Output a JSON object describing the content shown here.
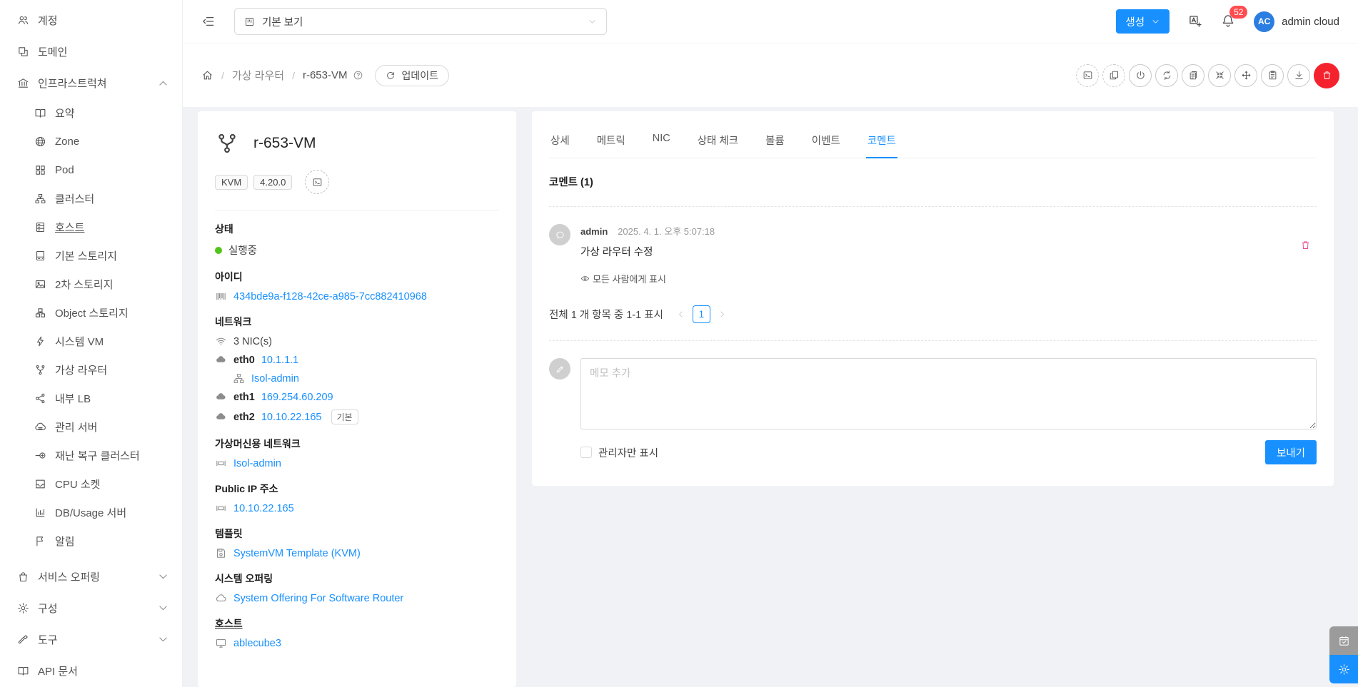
{
  "colors": {
    "primary": "#1890ff",
    "status_running": "#52c41a",
    "badge": "#ff4d4f",
    "danger": "#f5222d"
  },
  "header": {
    "view_select": {
      "value": "기본 보기"
    },
    "create_button": {
      "label": "생성"
    },
    "notification_count": "52",
    "user": {
      "initials": "AC",
      "name": "admin cloud"
    }
  },
  "breadcrumb": {
    "section": "가상 라우터",
    "current": "r-653-VM",
    "update_button": "업데이트"
  },
  "toolbar": [
    {
      "key": "console",
      "icon": "console",
      "style": "dashed"
    },
    {
      "key": "copy",
      "icon": "copy",
      "style": "dashed"
    },
    {
      "key": "power",
      "icon": "power",
      "style": "solid"
    },
    {
      "key": "restart",
      "icon": "sync",
      "style": "solid"
    },
    {
      "key": "diagnostics",
      "icon": "diagnostics",
      "style": "solid"
    },
    {
      "key": "scale",
      "icon": "shrink",
      "style": "solid"
    },
    {
      "key": "migrate",
      "icon": "migrate",
      "style": "solid"
    },
    {
      "key": "health-check",
      "icon": "clipboard",
      "style": "solid"
    },
    {
      "key": "download",
      "icon": "download",
      "style": "solid"
    },
    {
      "key": "delete",
      "icon": "trash",
      "style": "danger"
    }
  ],
  "sidebar": {
    "items": [
      {
        "key": "accounts",
        "icon": "team",
        "label": "계정",
        "level": "top"
      },
      {
        "key": "domains",
        "icon": "block",
        "label": "도메인",
        "level": "top"
      },
      {
        "key": "infrastructure",
        "icon": "bank",
        "label": "인프라스트럭쳐",
        "level": "top",
        "caret": "up"
      },
      {
        "key": "summary",
        "icon": "read",
        "label": "요약",
        "level": "sub"
      },
      {
        "key": "zones",
        "icon": "global",
        "label": "Zone",
        "level": "sub"
      },
      {
        "key": "pods",
        "icon": "appstore",
        "label": "Pod",
        "level": "sub"
      },
      {
        "key": "clusters",
        "icon": "cluster",
        "label": "클러스터",
        "level": "sub"
      },
      {
        "key": "hosts",
        "icon": "host",
        "label": "호스트",
        "level": "sub",
        "underline": true
      },
      {
        "key": "primary-storage",
        "icon": "hdd",
        "label": "기본 스토리지",
        "level": "sub"
      },
      {
        "key": "secondary-storage",
        "icon": "picture",
        "label": "2차 스토리지",
        "level": "sub"
      },
      {
        "key": "object-storage",
        "icon": "object",
        "label": "Object 스토리지",
        "level": "sub"
      },
      {
        "key": "system-vms",
        "icon": "thunderbolt",
        "label": "시스템 VM",
        "level": "sub"
      },
      {
        "key": "virtual-routers",
        "icon": "fork",
        "label": "가상 라우터",
        "level": "sub"
      },
      {
        "key": "internal-lb",
        "icon": "share",
        "label": "내부 LB",
        "level": "sub"
      },
      {
        "key": "management-servers",
        "icon": "cloud-server",
        "label": "관리 서버",
        "level": "sub"
      },
      {
        "key": "dr-clusters",
        "icon": "dr",
        "label": "재난 복구 클러스터",
        "level": "sub"
      },
      {
        "key": "cpu-sockets",
        "icon": "inbox",
        "label": "CPU 소켓",
        "level": "sub"
      },
      {
        "key": "db-usage-servers",
        "icon": "chart",
        "label": "DB/Usage 서버",
        "level": "sub"
      },
      {
        "key": "alerts",
        "icon": "flag",
        "label": "알림",
        "level": "sub"
      },
      {
        "key": "service-offerings",
        "icon": "shopping",
        "label": "서비스 오퍼링",
        "level": "top",
        "caret": "down",
        "gap": true
      },
      {
        "key": "configuration",
        "icon": "setting",
        "label": "구성",
        "level": "top",
        "caret": "down"
      },
      {
        "key": "tools",
        "icon": "tool",
        "label": "도구",
        "level": "top",
        "caret": "down"
      },
      {
        "key": "api-docs",
        "icon": "read",
        "label": "API 문서",
        "level": "top"
      }
    ]
  },
  "vm": {
    "title": "r-653-VM",
    "tags": [
      "KVM",
      "4.20.0"
    ],
    "status": {
      "label": "상태",
      "value": "실행중"
    },
    "id": {
      "label": "아이디",
      "value": "434bde9a-f128-42ce-a985-7cc882410968"
    },
    "network": {
      "label": "네트워크",
      "count": "3 NIC(s)",
      "nics": [
        {
          "name": "eth0",
          "ip": "10.1.1.1",
          "network": "Isol-admin"
        },
        {
          "name": "eth1",
          "ip": "169.254.60.209"
        },
        {
          "name": "eth2",
          "ip": "10.10.22.165",
          "tag": "기본"
        }
      ]
    },
    "vm_network": {
      "label": "가상머신용 네트워크",
      "value": "Isol-admin"
    },
    "public_ip": {
      "label": "Public IP 주소",
      "value": "10.10.22.165"
    },
    "template": {
      "label": "템플릿",
      "value": "SystemVM Template (KVM)"
    },
    "system_offering": {
      "label": "시스템 오퍼링",
      "value": "System Offering For Software Router"
    },
    "host": {
      "label": "호스트",
      "value": "ablecube3"
    }
  },
  "tabs": {
    "items": [
      {
        "key": "detail",
        "label": "상세"
      },
      {
        "key": "metrics",
        "label": "메트릭"
      },
      {
        "key": "nic",
        "label": "NIC"
      },
      {
        "key": "health-check",
        "label": "상태 체크"
      },
      {
        "key": "volume",
        "label": "볼륨"
      },
      {
        "key": "events",
        "label": "이벤트"
      },
      {
        "key": "comments",
        "label": "코멘트"
      }
    ],
    "active": "comments"
  },
  "comments": {
    "heading": "코멘트 (1)",
    "items": [
      {
        "author": "admin",
        "timestamp": "2025. 4. 1. 오후 5:07:18",
        "text": "가상 라우터 수정",
        "visibility": "모든 사람에게 표시"
      }
    ],
    "pagination": {
      "summary": "전체 1 개 항목 중 1-1 표시",
      "current": "1"
    },
    "composer": {
      "placeholder": "메모 추가",
      "admin_only": "관리자만 표시",
      "send": "보내기"
    }
  }
}
